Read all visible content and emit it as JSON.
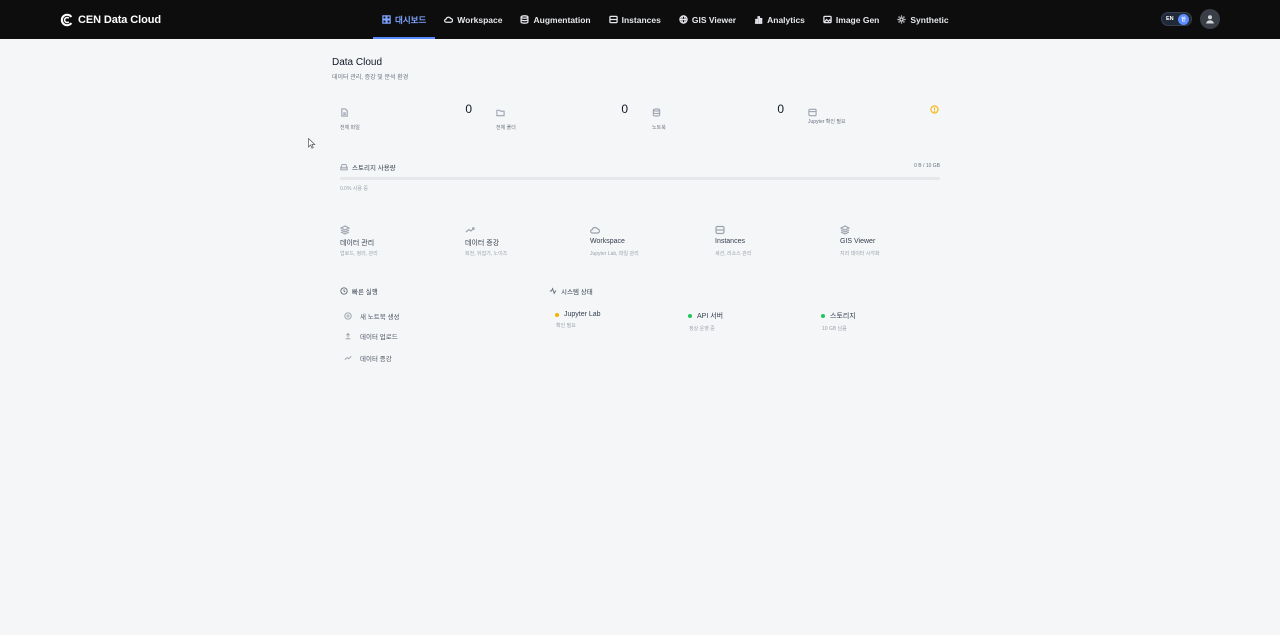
{
  "brand": {
    "name": "CEN Data Cloud"
  },
  "nav": [
    {
      "label": "대시보드",
      "icon": "dashboard-icon",
      "active": true
    },
    {
      "label": "Workspace",
      "icon": "cloud-icon"
    },
    {
      "label": "Augmentation",
      "icon": "database-icon"
    },
    {
      "label": "Instances",
      "icon": "server-icon"
    },
    {
      "label": "GIS Viewer",
      "icon": "globe-icon"
    },
    {
      "label": "Analytics",
      "icon": "bar-chart-icon"
    },
    {
      "label": "Image Gen",
      "icon": "image-icon"
    },
    {
      "label": "Synthetic",
      "icon": "sparkle-icon"
    }
  ],
  "lang": {
    "label": "EN",
    "alt": "한"
  },
  "page": {
    "title": "Data Cloud",
    "subtitle": "데이터 관리, 증강 및 분석 환경"
  },
  "stats": [
    {
      "label": "전체 파일",
      "value": "0",
      "icon": "file-icon"
    },
    {
      "label": "전체 폴더",
      "value": "0",
      "icon": "folder-icon"
    },
    {
      "label": "노트북",
      "value": "0",
      "icon": "notebook-icon"
    },
    {
      "label": "Jupyter 확인 필요",
      "value": "",
      "icon": "jupyter-icon"
    }
  ],
  "storage": {
    "title": "스토리지 사용량",
    "used": "0 B / 10 GB",
    "percent_text": "0.0% 사용 중",
    "percent": 0
  },
  "features": [
    {
      "name": "데이터 관리",
      "desc": "업로드, 정리, 관리",
      "icon": "layers-icon"
    },
    {
      "name": "데이터 증강",
      "desc": "회전, 뒤집기, 노이즈",
      "icon": "trend-icon"
    },
    {
      "name": "Workspace",
      "desc": "Jupyter Lab, 파일 관리",
      "icon": "cloud-icon"
    },
    {
      "name": "Instances",
      "desc": "세션, 리소스 관리",
      "icon": "server-icon"
    },
    {
      "name": "GIS Viewer",
      "desc": "지리 데이터 시각화",
      "icon": "layers-icon"
    }
  ],
  "quick": {
    "title": "빠른 실행",
    "items": [
      {
        "label": "새 노트북 생성",
        "icon": "plus-circle-icon"
      },
      {
        "label": "데이터 업로드",
        "icon": "upload-icon"
      },
      {
        "label": "데이터 증강",
        "icon": "trend-icon"
      }
    ]
  },
  "system": {
    "title": "시스템 상태",
    "items": [
      {
        "name": "Jupyter Lab",
        "status": "확인 필요",
        "color": "#f5b301"
      },
      {
        "name": "API 서버",
        "status": "정상 운영 중",
        "color": "#22c55e"
      },
      {
        "name": "스토리지",
        "status": "10 GB 남음",
        "color": "#22c55e"
      }
    ]
  }
}
